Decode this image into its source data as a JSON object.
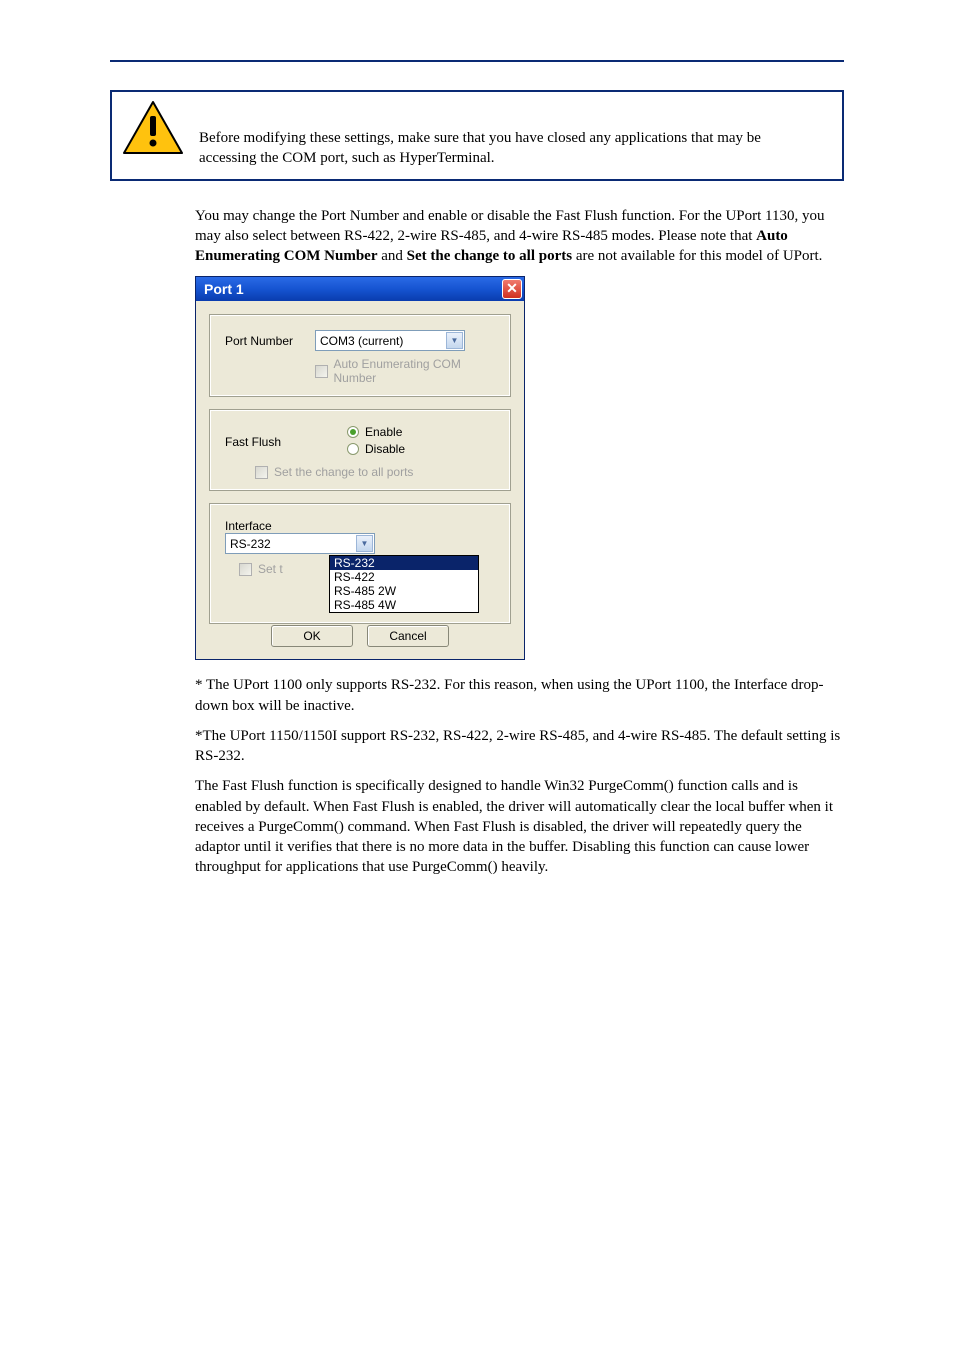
{
  "attention": "Before modifying these settings, make sure that you have closed any applications that may be accessing the COM port, such as HyperTerminal.",
  "para1_a": "You may change the Port Number and enable or disable the Fast Flush function. For the UPort 1130, you may also select between RS-422, 2-wire RS-485, and 4-wire RS-485 modes. Please note that ",
  "para1_b": "Auto Enumerating COM Number",
  "para1_c": " and ",
  "para1_d": "Set the change to all ports",
  "para1_e": " are not available for this model of UPort.",
  "para2": "* The UPort 1100 only supports RS-232. For this reason, when using the UPort 1100, the Interface drop-down box will be inactive.",
  "para3": "*The UPort 1150/1150I support RS-232, RS-422, 2-wire RS-485, and 4-wire RS-485. The default setting is RS-232.",
  "para4": "The Fast Flush function is specifically designed to handle Win32 PurgeComm() function calls and is enabled by default. When Fast Flush is enabled, the driver will automatically clear the local buffer when it receives a PurgeComm() command. When Fast Flush is disabled, the driver will repeatedly query the adaptor until it verifies that there is no more data in the buffer. Disabling this function can cause lower throughput for applications that use PurgeComm() heavily.",
  "dialog": {
    "title": "Port 1",
    "close_glyph": "✕",
    "port_number_label": "Port Number",
    "port_number_value": "COM3 (current)",
    "auto_enum": "Auto Enumerating COM Number",
    "fast_flush_label": "Fast Flush",
    "enable": "Enable",
    "disable": "Disable",
    "set_all": "Set the change to all ports",
    "interface_label": "Interface",
    "interface_value": "RS-232",
    "set_truncated": "Set t",
    "options": {
      "o1": "RS-232",
      "o2": "RS-422",
      "o3": "RS-485 2W",
      "o4": "RS-485 4W"
    },
    "ok": "OK",
    "cancel": "Cancel",
    "down_glyph": "▼"
  }
}
